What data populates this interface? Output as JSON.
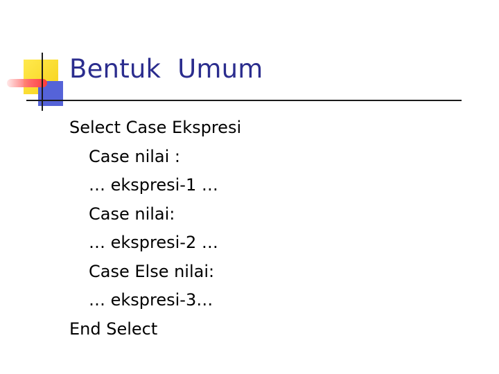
{
  "slide": {
    "title": "Bentuk  Umum",
    "lines": [
      {
        "text": "Select Case Ekspresi",
        "indent": false
      },
      {
        "text": "Case nilai :",
        "indent": true
      },
      {
        "text": "… ekspresi-1 …",
        "indent": true
      },
      {
        "text": "Case nilai:",
        "indent": true
      },
      {
        "text": "… ekspresi-2 …",
        "indent": true
      },
      {
        "text": "Case Else nilai:",
        "indent": true
      },
      {
        "text": "… ekspresi-3…",
        "indent": true
      },
      {
        "text": "End Select",
        "indent": false
      }
    ]
  },
  "colors": {
    "title": "#2b2d8e",
    "body": "#000000",
    "accent_yellow": "#f7d21a",
    "accent_blue": "#5563d8",
    "accent_red": "#ff3b3b",
    "rule": "#1a1a1a"
  }
}
